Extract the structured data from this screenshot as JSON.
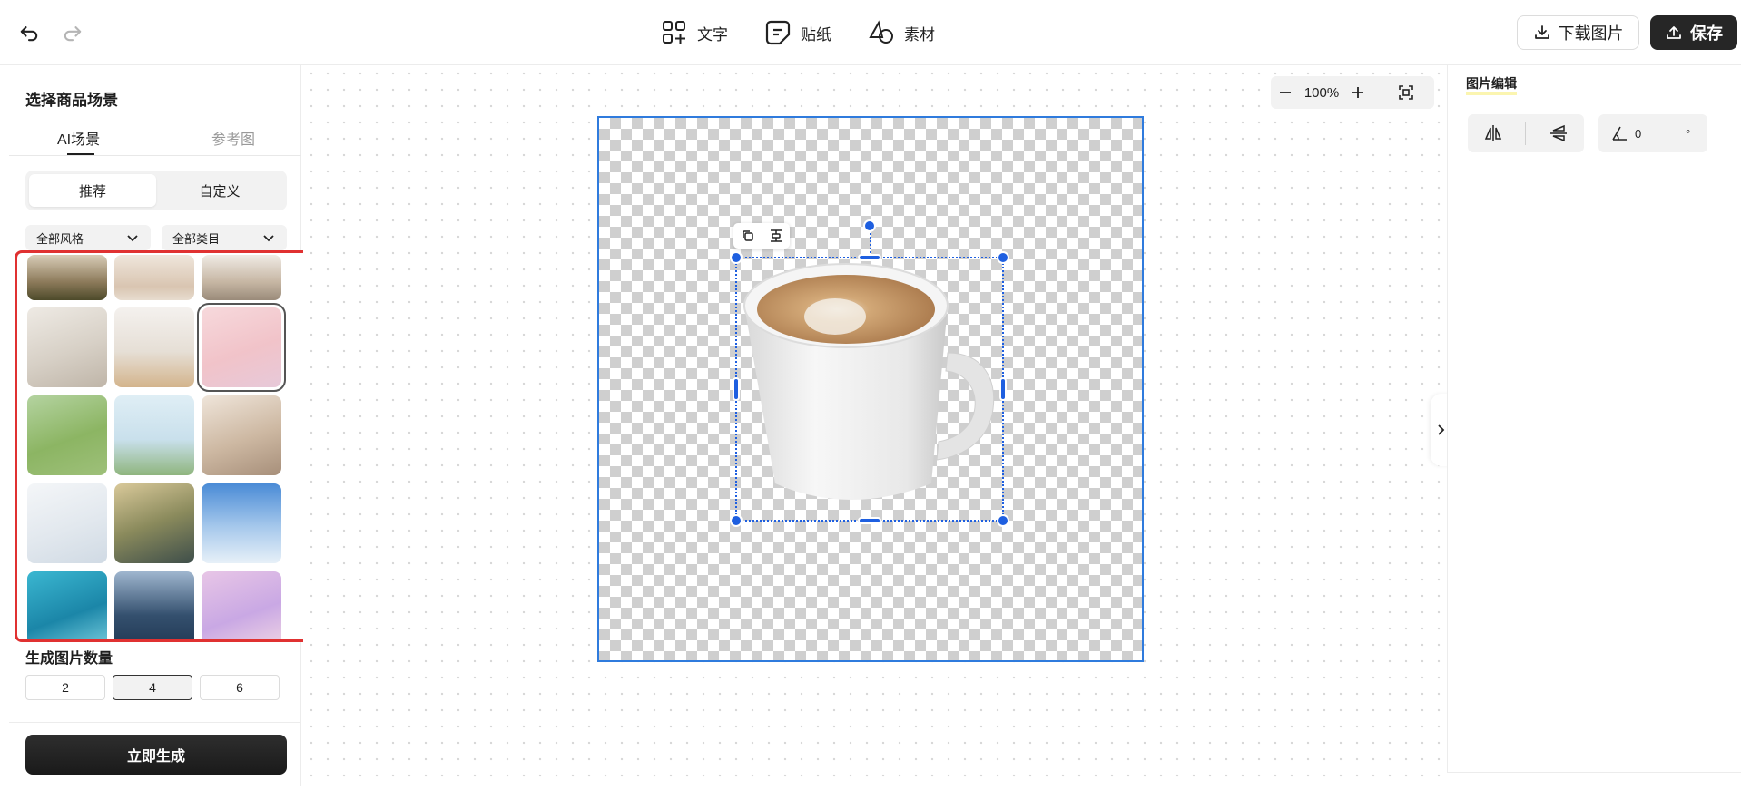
{
  "toolbar": {
    "undo_icon": "undo-icon",
    "redo_icon": "redo-icon",
    "tools": [
      {
        "label": "文字",
        "icon": "text-icon"
      },
      {
        "label": "贴纸",
        "icon": "sticker-icon"
      },
      {
        "label": "素材",
        "icon": "material-icon"
      }
    ],
    "download_label": "下载图片",
    "save_label": "保存"
  },
  "left_panel": {
    "title": "选择商品场景",
    "tabs": [
      "AI场景",
      "参考图"
    ],
    "active_tab": "AI场景",
    "segments": [
      "推荐",
      "自定义"
    ],
    "active_segment": "推荐",
    "style_filter": "全部风格",
    "category_filter": "全部类目",
    "selected_scene_index": 5,
    "count_title": "生成图片数量",
    "counts": [
      "2",
      "4",
      "6"
    ],
    "active_count": "4",
    "generate_label": "立即生成"
  },
  "canvas": {
    "zoom": "100%"
  },
  "right_panel": {
    "title": "图片编辑",
    "rotation_value": "0",
    "degree_unit": "°"
  },
  "colors": {
    "accent": "#1e5fe0",
    "highlight_border": "#e03131",
    "primary_button": "#262626"
  }
}
